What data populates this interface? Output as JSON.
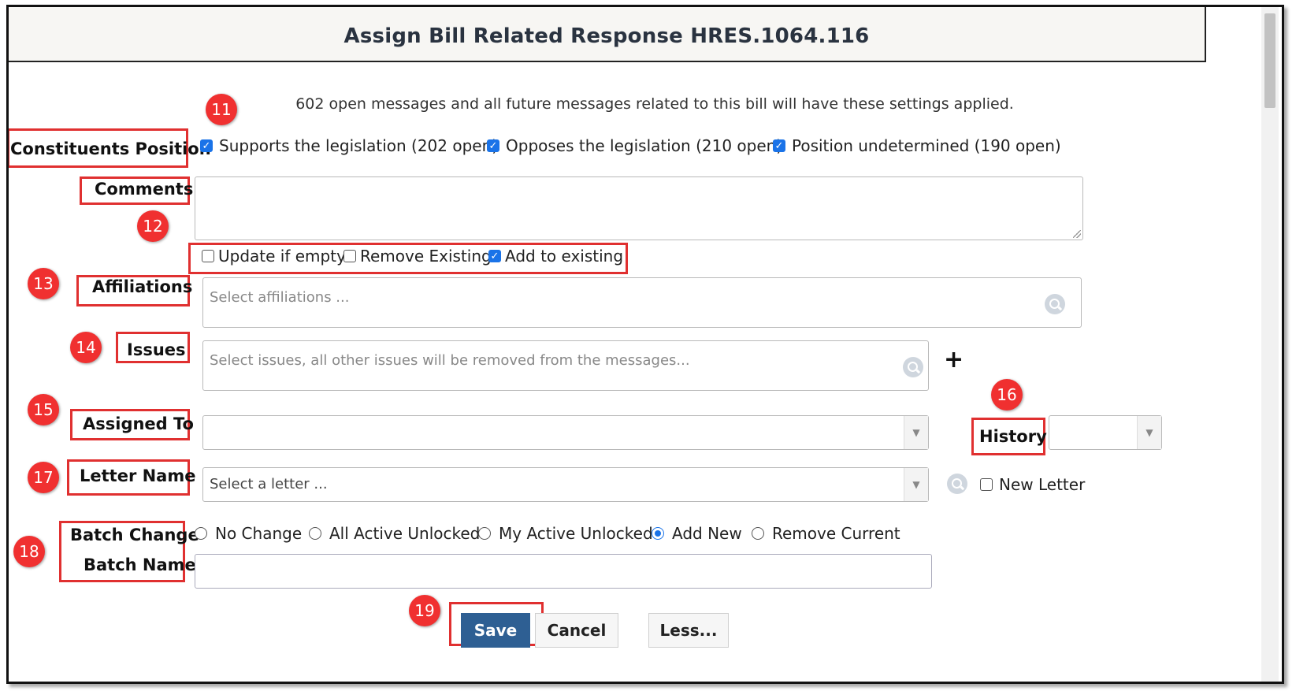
{
  "dialog": {
    "title": "Assign Bill Related Response HRES.1064.116",
    "info": "602 open messages and all future messages related to this bill will have these settings applied."
  },
  "constituents_position": {
    "label": "Constituents Position",
    "options": [
      {
        "label": "Supports the legislation (202 open)",
        "checked": true
      },
      {
        "label": "Opposes the legislation (210 open)",
        "checked": true
      },
      {
        "label": "Position undetermined (190 open)",
        "checked": true
      }
    ]
  },
  "comments": {
    "label": "Comments",
    "value": ""
  },
  "affiliation_mode": {
    "options": [
      {
        "label": "Update if empty",
        "checked": false
      },
      {
        "label": "Remove Existing",
        "checked": false
      },
      {
        "label": "Add to existing",
        "checked": true
      }
    ]
  },
  "affiliations": {
    "label": "Affiliations",
    "placeholder": "Select affiliations ..."
  },
  "issues": {
    "label": "Issues",
    "placeholder": "Select issues, all other issues will be removed from the messages...",
    "add_glyph": "+"
  },
  "assigned_to": {
    "label": "Assigned To",
    "value": ""
  },
  "history": {
    "label": "History",
    "value": ""
  },
  "letter": {
    "label": "Letter Name",
    "placeholder": "Select a letter ...",
    "new_letter_label": "New Letter",
    "new_letter_checked": false
  },
  "batch": {
    "change_label": "Batch Change",
    "name_label": "Batch Name",
    "options": [
      {
        "label": "No Change",
        "selected": false
      },
      {
        "label": "All Active Unlocked",
        "selected": false
      },
      {
        "label": "My Active Unlocked",
        "selected": false
      },
      {
        "label": "Add New",
        "selected": true
      },
      {
        "label": "Remove Current",
        "selected": false
      }
    ],
    "name_value": ""
  },
  "buttons": {
    "save": "Save",
    "cancel": "Cancel",
    "less": "Less..."
  },
  "badges": [
    "11",
    "12",
    "13",
    "14",
    "15",
    "16",
    "17",
    "18",
    "19"
  ],
  "colors": {
    "annotation_red": "#e03030",
    "badge_red": "#f03030",
    "primary_button": "#2e5f93",
    "checkbox_blue": "#1a73e8"
  },
  "icons": [
    "search-icon",
    "dropdown-arrow-icon",
    "plus-icon",
    "checkmark-icon"
  ]
}
